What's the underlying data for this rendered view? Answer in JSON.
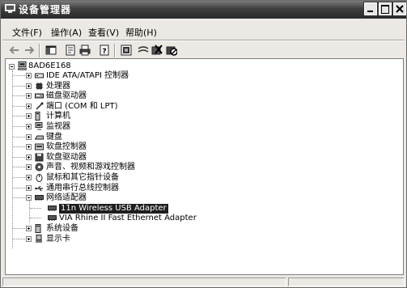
{
  "window": {
    "title": "设备管理器",
    "controls": [
      "minimize-icon",
      "maximize-icon",
      "close-icon"
    ]
  },
  "menu": [
    "文件(F)",
    "操作(A)",
    "查看(V)",
    "帮助(H)"
  ],
  "toolbar": {
    "icons": [
      "back-arrow-icon",
      "forward-arrow-icon",
      "show-hide-tree-icon",
      "properties-icon",
      "print-icon",
      "help-icon",
      "scan-hardware-icon",
      "update-driver-icon",
      "uninstall-icon",
      "disable-icon"
    ]
  },
  "tree": {
    "root": "8AD6E168",
    "items": [
      {
        "label": "IDE ATA/ATAPI 控制器",
        "icon": "ide-controller-icon"
      },
      {
        "label": "处理器",
        "icon": "processor-icon"
      },
      {
        "label": "磁盘驱动器",
        "icon": "disk-drive-icon"
      },
      {
        "label": "端口 (COM 和 LPT)",
        "icon": "port-icon"
      },
      {
        "label": "计算机",
        "icon": "computer-icon"
      },
      {
        "label": "监视器",
        "icon": "monitor-icon"
      },
      {
        "label": "键盘",
        "icon": "keyboard-icon"
      },
      {
        "label": "软盘控制器",
        "icon": "floppy-controller-icon"
      },
      {
        "label": "软盘驱动器",
        "icon": "floppy-drive-icon"
      },
      {
        "label": "声音、视频和游戏控制器",
        "icon": "sound-icon"
      },
      {
        "label": "鼠标和其它指针设备",
        "icon": "mouse-icon"
      },
      {
        "label": "通用串行总线控制器",
        "icon": "usb-icon"
      },
      {
        "label": "网络适配器",
        "icon": "network-adapter-icon",
        "expanded": true,
        "children": [
          {
            "label": "11n Wireless USB Adapter",
            "icon": "network-card-icon",
            "selected": true
          },
          {
            "label": "VIA Rhine II Fast Ethernet Adapter",
            "icon": "network-card-icon"
          }
        ]
      },
      {
        "label": "系统设备",
        "icon": "system-device-icon"
      },
      {
        "label": "显示卡",
        "icon": "display-adapter-icon"
      }
    ]
  }
}
